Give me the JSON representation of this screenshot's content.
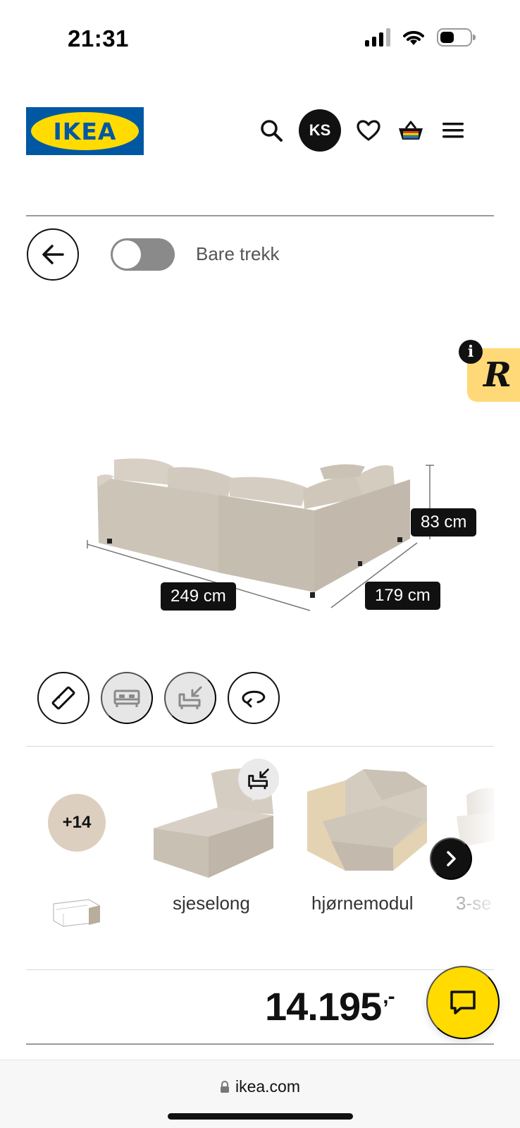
{
  "status_bar": {
    "time": "21:31"
  },
  "header": {
    "logo_text": "IKEA",
    "icons": [
      "search-icon",
      "account-avatar",
      "heart-icon",
      "basket-icon",
      "menu-icon"
    ],
    "avatar_initials": "KS"
  },
  "toolbar": {
    "back_icon": "arrow-left-icon",
    "toggle_label": "Bare trekk",
    "toggle_on": false
  },
  "info_badge": {
    "info": "i",
    "letter": "R"
  },
  "product_view": {
    "width_label": "249 cm",
    "depth_label": "179 cm",
    "height_label": "83 cm"
  },
  "view_modes": [
    {
      "icon": "ruler-icon",
      "active": true
    },
    {
      "icon": "bed-icon",
      "active": false
    },
    {
      "icon": "add-module-icon",
      "active": false
    },
    {
      "icon": "rotate-icon",
      "active": true
    }
  ],
  "modules": {
    "more_count": "+14",
    "items": [
      {
        "label": "sjeselong"
      },
      {
        "label": "hjørnemodul"
      },
      {
        "label": "3-se"
      }
    ]
  },
  "price": {
    "amount": "14.195",
    "suffix": ",-"
  },
  "browser": {
    "domain": "ikea.com"
  },
  "colors": {
    "ikea_blue": "#0058a3",
    "ikea_yellow": "#ffdb00",
    "sofa_beige": "#cdc4b8",
    "badge_yellow": "#ffd978"
  }
}
